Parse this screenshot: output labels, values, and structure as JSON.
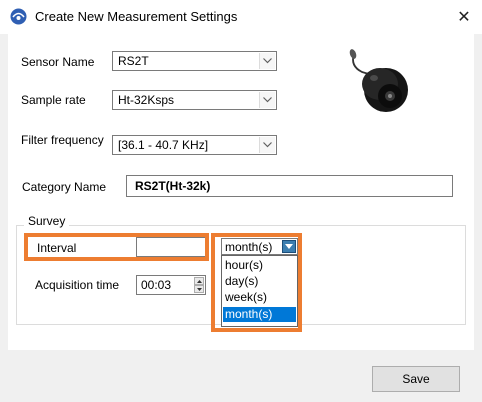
{
  "window": {
    "title": "Create New Measurement Settings",
    "app_icon": "logo-icon",
    "close_glyph": "✕"
  },
  "form": {
    "sensor_name": {
      "label": "Sensor Name",
      "value": "RS2T"
    },
    "sample_rate": {
      "label": "Sample rate",
      "value": "Ht-32Ksps"
    },
    "filter_frequency": {
      "label": "Filter frequency",
      "value": "[36.1 - 40.7 KHz]"
    },
    "category_name": {
      "label": "Category Name",
      "value": "RS2T(Ht-32k)"
    }
  },
  "survey": {
    "group_label": "Survey",
    "interval": {
      "label": "Interval",
      "value": "",
      "unit_selected": "month(s)",
      "unit_options": [
        "hour(s)",
        "day(s)",
        "week(s)",
        "month(s)"
      ],
      "dropdown_open": true
    },
    "acquisition_time": {
      "label": "Acquisition time",
      "value": "00:03"
    }
  },
  "footer": {
    "save_label": "Save"
  },
  "colors": {
    "highlight": "#ed7d31",
    "selection": "#0078d7",
    "dialog_bg": "#f0f0f0",
    "panel_bg": "#ffffff"
  },
  "image": {
    "icon": "sensor-icon"
  }
}
